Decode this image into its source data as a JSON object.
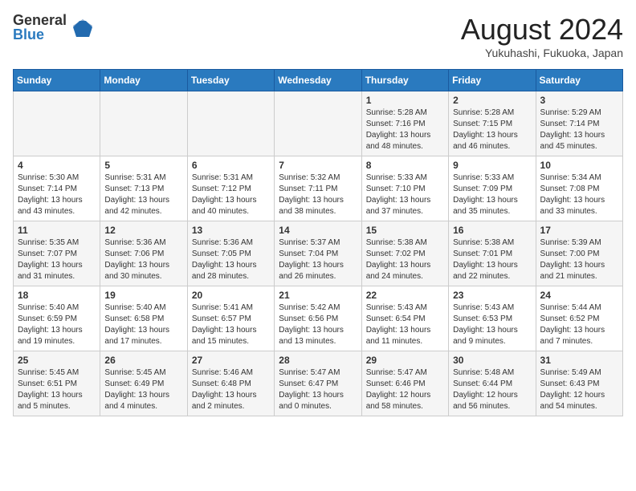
{
  "logo": {
    "general": "General",
    "blue": "Blue"
  },
  "header": {
    "month_year": "August 2024",
    "location": "Yukuhashi, Fukuoka, Japan"
  },
  "weekdays": [
    "Sunday",
    "Monday",
    "Tuesday",
    "Wednesday",
    "Thursday",
    "Friday",
    "Saturday"
  ],
  "weeks": [
    [
      {
        "day": "",
        "detail": ""
      },
      {
        "day": "",
        "detail": ""
      },
      {
        "day": "",
        "detail": ""
      },
      {
        "day": "",
        "detail": ""
      },
      {
        "day": "1",
        "detail": "Sunrise: 5:28 AM\nSunset: 7:16 PM\nDaylight: 13 hours\nand 48 minutes."
      },
      {
        "day": "2",
        "detail": "Sunrise: 5:28 AM\nSunset: 7:15 PM\nDaylight: 13 hours\nand 46 minutes."
      },
      {
        "day": "3",
        "detail": "Sunrise: 5:29 AM\nSunset: 7:14 PM\nDaylight: 13 hours\nand 45 minutes."
      }
    ],
    [
      {
        "day": "4",
        "detail": "Sunrise: 5:30 AM\nSunset: 7:14 PM\nDaylight: 13 hours\nand 43 minutes."
      },
      {
        "day": "5",
        "detail": "Sunrise: 5:31 AM\nSunset: 7:13 PM\nDaylight: 13 hours\nand 42 minutes."
      },
      {
        "day": "6",
        "detail": "Sunrise: 5:31 AM\nSunset: 7:12 PM\nDaylight: 13 hours\nand 40 minutes."
      },
      {
        "day": "7",
        "detail": "Sunrise: 5:32 AM\nSunset: 7:11 PM\nDaylight: 13 hours\nand 38 minutes."
      },
      {
        "day": "8",
        "detail": "Sunrise: 5:33 AM\nSunset: 7:10 PM\nDaylight: 13 hours\nand 37 minutes."
      },
      {
        "day": "9",
        "detail": "Sunrise: 5:33 AM\nSunset: 7:09 PM\nDaylight: 13 hours\nand 35 minutes."
      },
      {
        "day": "10",
        "detail": "Sunrise: 5:34 AM\nSunset: 7:08 PM\nDaylight: 13 hours\nand 33 minutes."
      }
    ],
    [
      {
        "day": "11",
        "detail": "Sunrise: 5:35 AM\nSunset: 7:07 PM\nDaylight: 13 hours\nand 31 minutes."
      },
      {
        "day": "12",
        "detail": "Sunrise: 5:36 AM\nSunset: 7:06 PM\nDaylight: 13 hours\nand 30 minutes."
      },
      {
        "day": "13",
        "detail": "Sunrise: 5:36 AM\nSunset: 7:05 PM\nDaylight: 13 hours\nand 28 minutes."
      },
      {
        "day": "14",
        "detail": "Sunrise: 5:37 AM\nSunset: 7:04 PM\nDaylight: 13 hours\nand 26 minutes."
      },
      {
        "day": "15",
        "detail": "Sunrise: 5:38 AM\nSunset: 7:02 PM\nDaylight: 13 hours\nand 24 minutes."
      },
      {
        "day": "16",
        "detail": "Sunrise: 5:38 AM\nSunset: 7:01 PM\nDaylight: 13 hours\nand 22 minutes."
      },
      {
        "day": "17",
        "detail": "Sunrise: 5:39 AM\nSunset: 7:00 PM\nDaylight: 13 hours\nand 21 minutes."
      }
    ],
    [
      {
        "day": "18",
        "detail": "Sunrise: 5:40 AM\nSunset: 6:59 PM\nDaylight: 13 hours\nand 19 minutes."
      },
      {
        "day": "19",
        "detail": "Sunrise: 5:40 AM\nSunset: 6:58 PM\nDaylight: 13 hours\nand 17 minutes."
      },
      {
        "day": "20",
        "detail": "Sunrise: 5:41 AM\nSunset: 6:57 PM\nDaylight: 13 hours\nand 15 minutes."
      },
      {
        "day": "21",
        "detail": "Sunrise: 5:42 AM\nSunset: 6:56 PM\nDaylight: 13 hours\nand 13 minutes."
      },
      {
        "day": "22",
        "detail": "Sunrise: 5:43 AM\nSunset: 6:54 PM\nDaylight: 13 hours\nand 11 minutes."
      },
      {
        "day": "23",
        "detail": "Sunrise: 5:43 AM\nSunset: 6:53 PM\nDaylight: 13 hours\nand 9 minutes."
      },
      {
        "day": "24",
        "detail": "Sunrise: 5:44 AM\nSunset: 6:52 PM\nDaylight: 13 hours\nand 7 minutes."
      }
    ],
    [
      {
        "day": "25",
        "detail": "Sunrise: 5:45 AM\nSunset: 6:51 PM\nDaylight: 13 hours\nand 5 minutes."
      },
      {
        "day": "26",
        "detail": "Sunrise: 5:45 AM\nSunset: 6:49 PM\nDaylight: 13 hours\nand 4 minutes."
      },
      {
        "day": "27",
        "detail": "Sunrise: 5:46 AM\nSunset: 6:48 PM\nDaylight: 13 hours\nand 2 minutes."
      },
      {
        "day": "28",
        "detail": "Sunrise: 5:47 AM\nSunset: 6:47 PM\nDaylight: 13 hours\nand 0 minutes."
      },
      {
        "day": "29",
        "detail": "Sunrise: 5:47 AM\nSunset: 6:46 PM\nDaylight: 12 hours\nand 58 minutes."
      },
      {
        "day": "30",
        "detail": "Sunrise: 5:48 AM\nSunset: 6:44 PM\nDaylight: 12 hours\nand 56 minutes."
      },
      {
        "day": "31",
        "detail": "Sunrise: 5:49 AM\nSunset: 6:43 PM\nDaylight: 12 hours\nand 54 minutes."
      }
    ]
  ]
}
